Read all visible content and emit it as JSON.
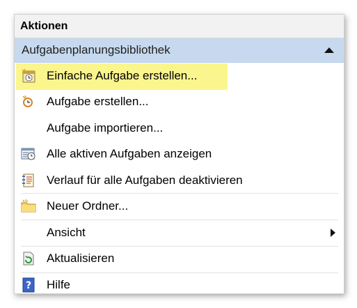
{
  "panel": {
    "title": "Aktionen"
  },
  "section": {
    "title": "Aufgabenplanungsbibliothek"
  },
  "items": [
    {
      "label": "Einfache Aufgabe erstellen...",
      "icon": "calendar-task-icon"
    },
    {
      "label": "Aufgabe erstellen...",
      "icon": "task-clock-icon"
    },
    {
      "label": "Aufgabe importieren...",
      "icon": ""
    },
    {
      "label": "Alle aktiven Aufgaben anzeigen",
      "icon": "list-calendar-icon"
    },
    {
      "label": "Verlauf für alle Aufgaben deaktivieren",
      "icon": "history-log-icon"
    },
    {
      "label": "Neuer Ordner...",
      "icon": "folder-icon"
    },
    {
      "label": "Ansicht",
      "icon": ""
    },
    {
      "label": "Aktualisieren",
      "icon": "refresh-icon"
    },
    {
      "label": "Hilfe",
      "icon": "help-icon"
    }
  ],
  "colors": {
    "section_bar": "#c6d9ee",
    "highlight": "#fbf58d",
    "header_bg": "#f2f2f2"
  }
}
